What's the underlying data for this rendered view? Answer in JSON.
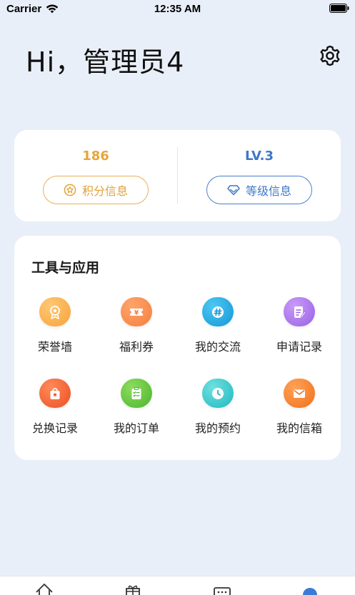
{
  "status_bar": {
    "carrier": "Carrier",
    "time": "12:35 AM"
  },
  "header": {
    "greeting": "Hi，管理员4"
  },
  "stats": {
    "points": {
      "value": "186",
      "button_label": "积分信息"
    },
    "level": {
      "value": "LV.3",
      "button_label": "等级信息"
    }
  },
  "tools": {
    "title": "工具与应用",
    "items": [
      {
        "label": "荣誉墙",
        "icon": "medal-icon",
        "color": "#f7a23c"
      },
      {
        "label": "福利券",
        "icon": "coupon-icon",
        "color": "#f47e3e"
      },
      {
        "label": "我的交流",
        "icon": "hashtag-icon",
        "color": "#1fa6e0"
      },
      {
        "label": "申请记录",
        "icon": "document-edit-icon",
        "color": "#a86bea"
      },
      {
        "label": "兑换记录",
        "icon": "gift-bag-icon",
        "color": "#f25c2a"
      },
      {
        "label": "我的订单",
        "icon": "clipboard-list-icon",
        "color": "#5cc23b"
      },
      {
        "label": "我的预约",
        "icon": "clock-icon",
        "color": "#28c2c6"
      },
      {
        "label": "我的信箱",
        "icon": "envelope-icon",
        "color": "#f2771f"
      }
    ]
  },
  "tabbar": {
    "tabs": [
      {
        "icon": "home-icon"
      },
      {
        "icon": "gift-icon"
      },
      {
        "icon": "message-icon"
      },
      {
        "icon": "profile-icon",
        "active": true
      }
    ],
    "active_color": "#3a7bd5"
  }
}
